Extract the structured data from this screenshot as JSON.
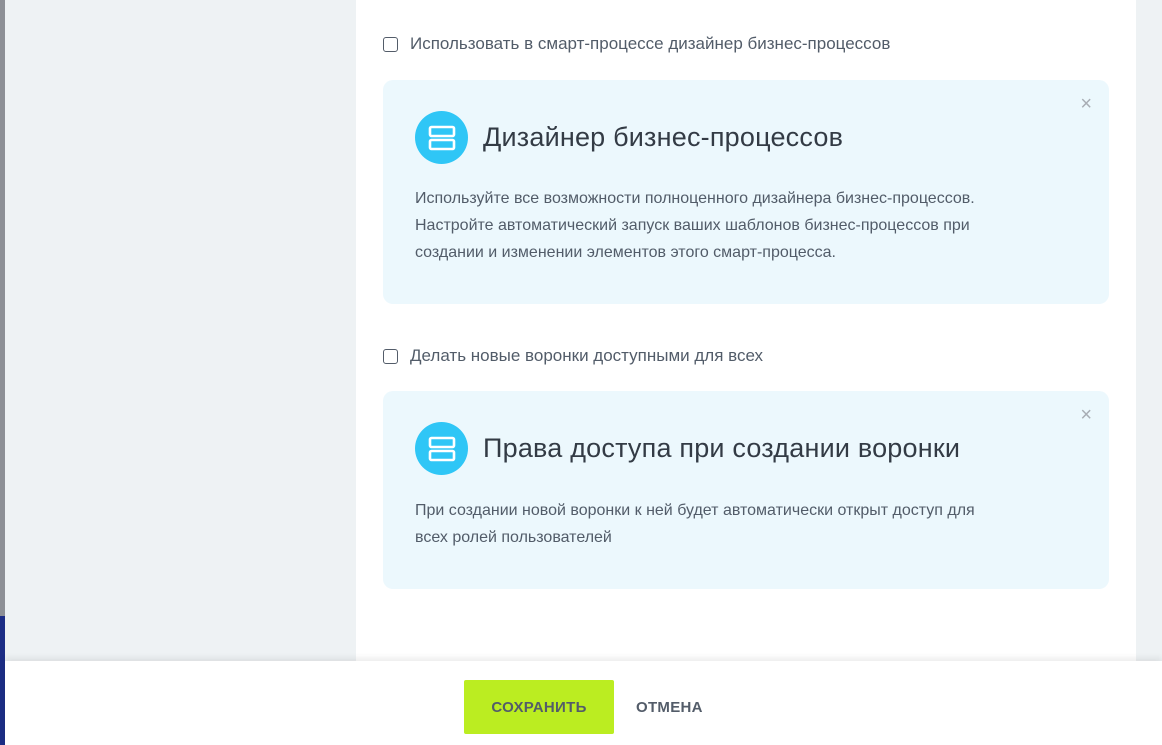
{
  "colors": {
    "accent_icon": "#2fc6f6",
    "card_bg": "#ecf8fd",
    "save_button": "#bbed21",
    "page_bg": "#eef2f4"
  },
  "settings": {
    "bp_designer_checkbox": {
      "label": "Использовать в смарт-процессе дизайнер бизнес-процессов",
      "checked": false
    },
    "bp_designer_card": {
      "icon": "server-stack-icon",
      "title": "Дизайнер бизнес-процессов",
      "lines": [
        "Используйте все возможности полноценного дизайнера бизнес-процессов.",
        "Настройте автоматический запуск ваших шаблонов бизнес-процессов при",
        "создании и изменении элементов этого смарт-процесса."
      ],
      "close": "×"
    },
    "funnels_checkbox": {
      "label": "Делать новые воронки доступными для всех",
      "checked": false
    },
    "funnels_card": {
      "icon": "server-stack-icon",
      "title": "Права доступа при создании воронки",
      "lines": [
        "При создании новой воронки к ней будет автоматически открыт доступ для",
        "всех ролей пользователей"
      ],
      "close": "×"
    }
  },
  "footer": {
    "save_label": "СОХРАНИТЬ",
    "cancel_label": "ОТМЕНА"
  }
}
